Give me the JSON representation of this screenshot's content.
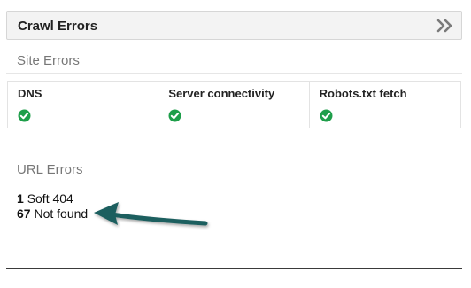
{
  "header": {
    "title": "Crawl Errors",
    "expand_icon": "double-chevron-right-icon"
  },
  "site_errors": {
    "title": "Site Errors",
    "items": [
      {
        "label": "DNS",
        "status_icon": "check-circle-icon",
        "status_color": "#1e9e4a"
      },
      {
        "label": "Server connectivity",
        "status_icon": "check-circle-icon",
        "status_color": "#1e9e4a"
      },
      {
        "label": "Robots.txt fetch",
        "status_icon": "check-circle-icon",
        "status_color": "#1e9e4a"
      }
    ]
  },
  "url_errors": {
    "title": "URL Errors",
    "items": [
      {
        "count": "1",
        "label": "Soft 404"
      },
      {
        "count": "67",
        "label": "Not found"
      }
    ]
  },
  "annotation": {
    "arrow_icon": "annotation-arrow-icon",
    "color": "#1c5e5e"
  }
}
